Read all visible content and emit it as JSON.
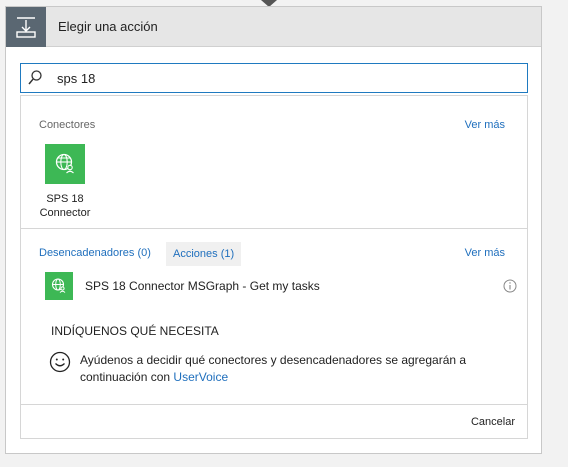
{
  "header": {
    "title": "Elegir una acción",
    "icon": "action-step-icon"
  },
  "search": {
    "value": "sps 18",
    "icon": "search-icon"
  },
  "connectors": {
    "label": "Conectores",
    "see_more": "Ver más",
    "items": [
      {
        "name_line1": "SPS 18",
        "name_line2": "Connector",
        "icon": "globe-person-icon",
        "color": "#3db855"
      }
    ]
  },
  "tabs": {
    "triggers": "Desencadenadores (0)",
    "actions": "Acciones (1)",
    "see_more": "Ver más"
  },
  "actions": [
    {
      "label": "SPS 18 Connector MSGraph - Get my tasks",
      "icon": "globe-person-icon"
    }
  ],
  "feedback": {
    "heading": "INDÍQUENOS QUÉ NECESITA",
    "text": "Ayúdenos a decidir qué conectores y desencadenadores se agregarán a continuación con",
    "link": "UserVoice",
    "icon": "smiley-icon"
  },
  "footer": {
    "cancel": "Cancelar"
  },
  "colors": {
    "accent": "#1f6fbd",
    "connector_green": "#3db855",
    "header_icon_bg": "#5a6772"
  }
}
